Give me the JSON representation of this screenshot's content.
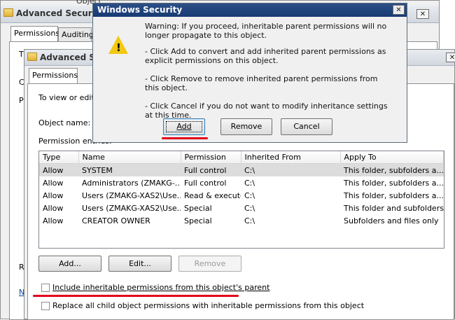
{
  "back_window": {
    "title": "Advanced Security",
    "tabs": [
      "Permissions",
      "Auditing"
    ],
    "fragments": {
      "top": "Object",
      "t": "T",
      "c": "C",
      "p": "P",
      "r": "R",
      "n": "N"
    }
  },
  "mid_window": {
    "title": "Advanced Sec",
    "tab": "Permissions",
    "intro_text": "To view or edit c",
    "object_name_label": "Object name:",
    "permission_entries_label": "Permission entries:",
    "columns": [
      "Type",
      "Name",
      "Permission",
      "Inherited From",
      "Apply To"
    ],
    "rows": [
      {
        "type": "Allow",
        "name": "SYSTEM",
        "permission": "Full control",
        "inherited": "C:\\",
        "apply": "This folder, subfolders a..."
      },
      {
        "type": "Allow",
        "name": "Administrators (ZMAKG-...",
        "permission": "Full control",
        "inherited": "C:\\",
        "apply": "This folder, subfolders a..."
      },
      {
        "type": "Allow",
        "name": "Users (ZMAKG-XAS2\\Use...",
        "permission": "Read & execute",
        "inherited": "C:\\",
        "apply": "This folder, subfolders a..."
      },
      {
        "type": "Allow",
        "name": "Users (ZMAKG-XAS2\\Use...",
        "permission": "Special",
        "inherited": "C:\\",
        "apply": "This folder and subfolders"
      },
      {
        "type": "Allow",
        "name": "CREATOR OWNER",
        "permission": "Special",
        "inherited": "C:\\",
        "apply": "Subfolders and files only"
      }
    ],
    "add_button": "Add...",
    "edit_button": "Edit...",
    "remove_button": "Remove",
    "include_inheritable": "Include inheritable permissions from this object's parent",
    "replace_child": "Replace all child object permissions with inheritable permissions from this object"
  },
  "dialog": {
    "title": "Windows Security",
    "close_glyph": "✕",
    "message_lines": [
      "Warning: If you proceed, inheritable parent permissions will no longer propagate to this object.",
      "- Click Add to convert and add inherited parent permissions as explicit permissions on this object.",
      "- Click Remove to remove inherited parent permissions from this object.",
      "- Click Cancel if you do not want to modify inheritance settings at this time."
    ],
    "add_button": "Add",
    "remove_button": "Remove",
    "cancel_button": "Cancel"
  },
  "colors": {
    "highlight_red": "#e3001b",
    "warning_yellow": "#f2c812"
  }
}
